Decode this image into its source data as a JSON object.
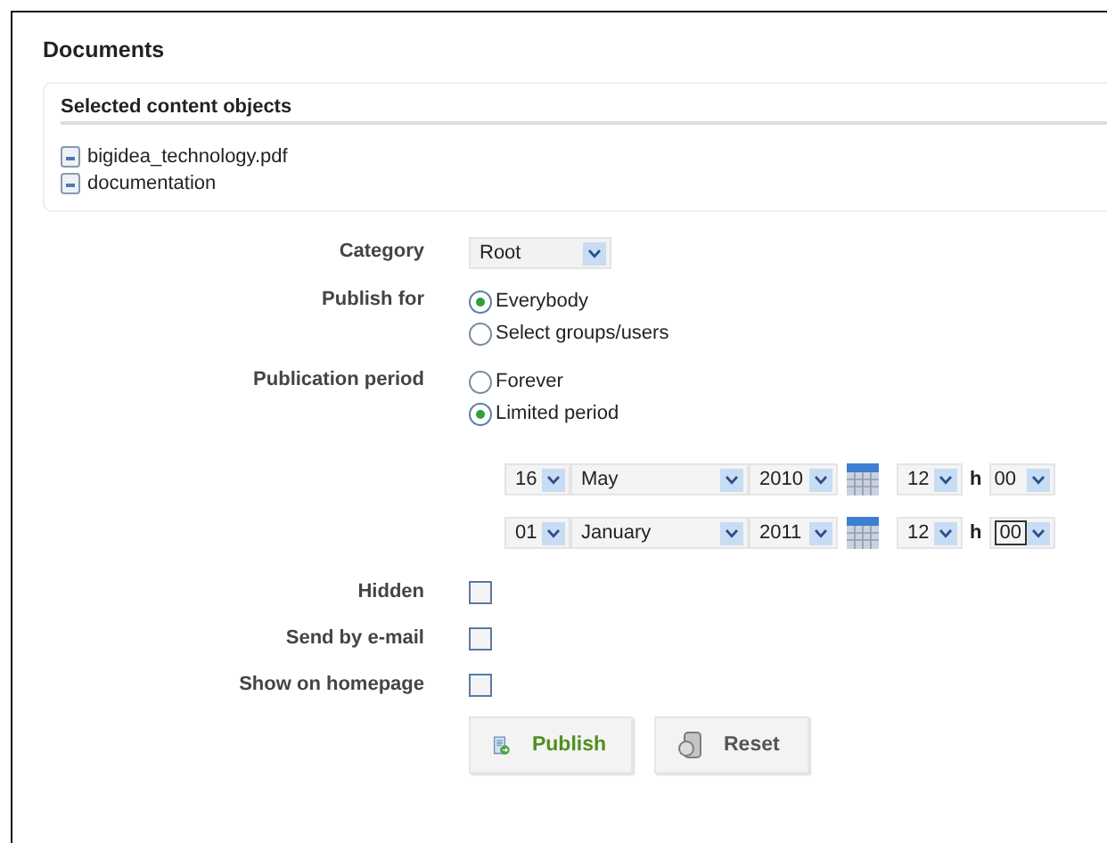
{
  "page": {
    "title": "Documents"
  },
  "selected_objects": {
    "heading": "Selected content objects",
    "items": [
      "bigidea_technology.pdf",
      "documentation"
    ]
  },
  "fields": [
    {
      "kind": "select",
      "label": "Category",
      "value": "Root"
    },
    {
      "kind": "radio",
      "label": "Publish for",
      "options": [
        {
          "label": "Everybody",
          "selected": true
        },
        {
          "label": "Select groups/users",
          "selected": false
        }
      ]
    },
    {
      "kind": "radio",
      "label": "Publication period",
      "options": [
        {
          "label": "Forever",
          "selected": false
        },
        {
          "label": "Limited period",
          "selected": true
        }
      ]
    },
    {
      "kind": "dates",
      "rows": [
        {
          "day": "16",
          "month": "May",
          "year": "2010",
          "hour": "12",
          "hour_unit": "h",
          "minute": "00",
          "minute_focused": false
        },
        {
          "day": "01",
          "month": "January",
          "year": "2011",
          "hour": "12",
          "hour_unit": "h",
          "minute": "00",
          "minute_focused": true
        }
      ]
    },
    {
      "kind": "checkbox",
      "label": "Hidden",
      "checked": false
    },
    {
      "kind": "checkbox",
      "label": "Send by e-mail",
      "checked": false
    },
    {
      "kind": "checkbox",
      "label": "Show on homepage",
      "checked": false
    }
  ],
  "buttons": [
    {
      "label": "Publish",
      "kind": "publish"
    },
    {
      "label": "Reset",
      "kind": "reset"
    }
  ]
}
